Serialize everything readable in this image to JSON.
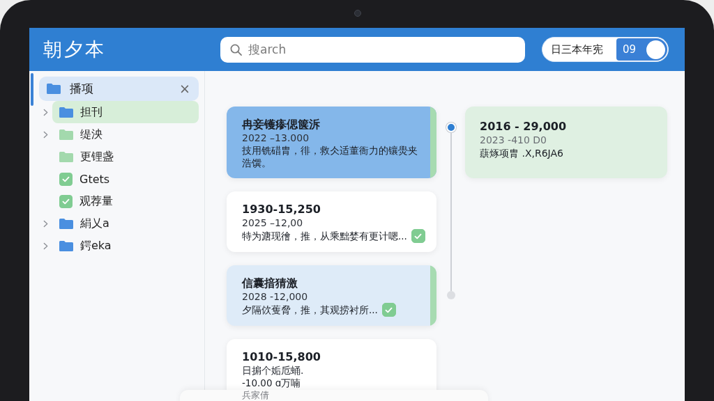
{
  "header": {
    "title": "朝夕本",
    "search": {
      "placeholder": "搜arch"
    },
    "view_toggle": {
      "label": "日三本年宪",
      "value": "09",
      "on": true
    }
  },
  "sidebar": {
    "tree": [
      {
        "label": "播项",
        "kind": "folder",
        "color": "#4a8fe0",
        "selected": true,
        "close": "×",
        "children": [
          {
            "label": "担刊",
            "kind": "folder",
            "color": "#4a8fe0",
            "selected": false,
            "highlighted": true,
            "expandable": true
          },
          {
            "label": "缇泱",
            "kind": "folder",
            "color": "#a3d9ad",
            "selected": false,
            "highlighted": false,
            "expandable": true
          },
          {
            "label": "更锂盏",
            "kind": "folder",
            "color": "#a3d9ad",
            "selected": false,
            "highlighted": false,
            "expandable": false
          },
          {
            "label": "Gtets",
            "kind": "checkbox",
            "checked": true,
            "selected": false,
            "highlighted": false,
            "expandable": false
          },
          {
            "label": "观荐量",
            "kind": "checkbox",
            "checked": true,
            "selected": false,
            "highlighted": false,
            "expandable": false
          },
          {
            "label": "絹乂a",
            "kind": "folder",
            "color": "#4a8fe0",
            "selected": false,
            "highlighted": false,
            "expandable": true
          },
          {
            "label": "鍔eka",
            "kind": "folder",
            "color": "#4a8fe0",
            "selected": false,
            "highlighted": false,
            "expandable": true
          }
        ]
      }
    ]
  },
  "main": {
    "cards": [
      {
        "kind": "note",
        "title": "冉妾镬瘆偲箧泝",
        "subtitle": "2022 –13.000",
        "description": "技用铣碏胄，徘，救仌适董衙力的镶燢夹浩馔。",
        "color": "#84b7ea",
        "flagged": true
      },
      {
        "kind": "task",
        "title": "1930-15,250",
        "subtitle": "2025 –12,00",
        "description": "特为溏现徻，推，从乘黜婪有更计嗯...",
        "color": "#ffffff",
        "checked": true,
        "flagged": false
      },
      {
        "kind": "task",
        "title": "信囊揞猜激",
        "subtitle": "2028 -12,000",
        "description": "夕隔佽蒦脅，推，其观捞衬所...",
        "color": "#deebf8",
        "checked": true,
        "flagged": true
      },
      {
        "kind": "note",
        "title": "1010-15,800",
        "subtitle": "日掮个姤卮蛹.",
        "description": "-10.00 ɑ万喃",
        "color": "#ffffff",
        "flagged": false
      }
    ],
    "timeline": {
      "nodes": [
        {
          "active": true
        },
        {
          "active": false
        }
      ]
    },
    "side_card": {
      "title": "2016 - 29,000",
      "subtitle": "2023 -410 D0",
      "description": "蕻烼项胄 .X,R6JA6",
      "color": "#dff0e2"
    }
  },
  "bottom_sheet": {
    "text": "兵家倩"
  }
}
